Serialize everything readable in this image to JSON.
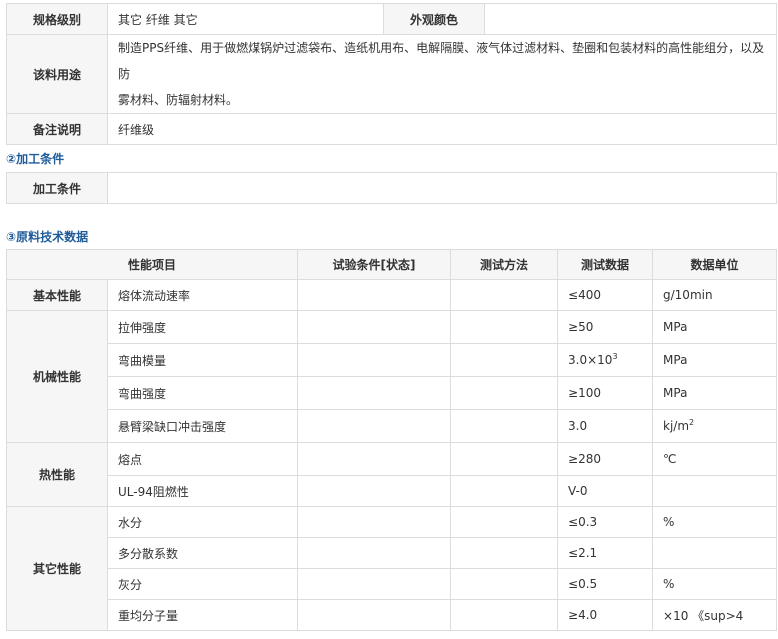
{
  "spec": {
    "grade_label": "规格级别",
    "grade_value": "其它 纤维 其它",
    "color_label": "外观颜色",
    "color_value": "",
    "usage_label": "该料用途",
    "usage_value_line1": "制造PPS纤维、用于做燃煤锅炉过滤袋布、造纸机用布、电解隔膜、液气体过滤材料、垫圈和包装材料的高性能组分，以及防",
    "usage_value_line2": "雾材料、防辐射材料。",
    "note_label": "备注说明",
    "note_value": "纤维级"
  },
  "processing": {
    "section_title": "②加工条件",
    "label": "加工条件",
    "value": ""
  },
  "tech": {
    "section_title": "③原料技术数据",
    "headers": {
      "property": "性能项目",
      "condition": "试验条件[状态]",
      "method": "测试方法",
      "data": "测试数据",
      "unit": "数据单位"
    },
    "groups": {
      "basic": "基本性能",
      "mechanical": "机械性能",
      "thermal": "热性能",
      "other": "其它性能"
    },
    "rows": [
      {
        "name": "熔体流动速率",
        "data": "≤400",
        "unit": "g/10min"
      },
      {
        "name": "拉伸强度",
        "data": "≥50",
        "unit": "MPa"
      },
      {
        "name": "弯曲模量",
        "data": "3.0×10",
        "data_sup": "3",
        "unit": "MPa"
      },
      {
        "name": "弯曲强度",
        "data": "≥100",
        "unit": "MPa"
      },
      {
        "name": "悬臂梁缺口冲击强度",
        "data": "3.0",
        "unit": "kj/m",
        "unit_sup": "2"
      },
      {
        "name": "熔点",
        "data": "≥280",
        "unit": "℃"
      },
      {
        "name": "UL-94阻燃性",
        "data": "V-0",
        "unit": ""
      },
      {
        "name": "水分",
        "data": "≤0.3",
        "unit": "%"
      },
      {
        "name": "多分散系数",
        "data": "≤2.1",
        "unit": ""
      },
      {
        "name": "灰分",
        "data": "≤0.5",
        "unit": "%"
      },
      {
        "name": "重均分子量",
        "data": "≥4.0",
        "unit": "×10 《sup>4"
      }
    ]
  }
}
